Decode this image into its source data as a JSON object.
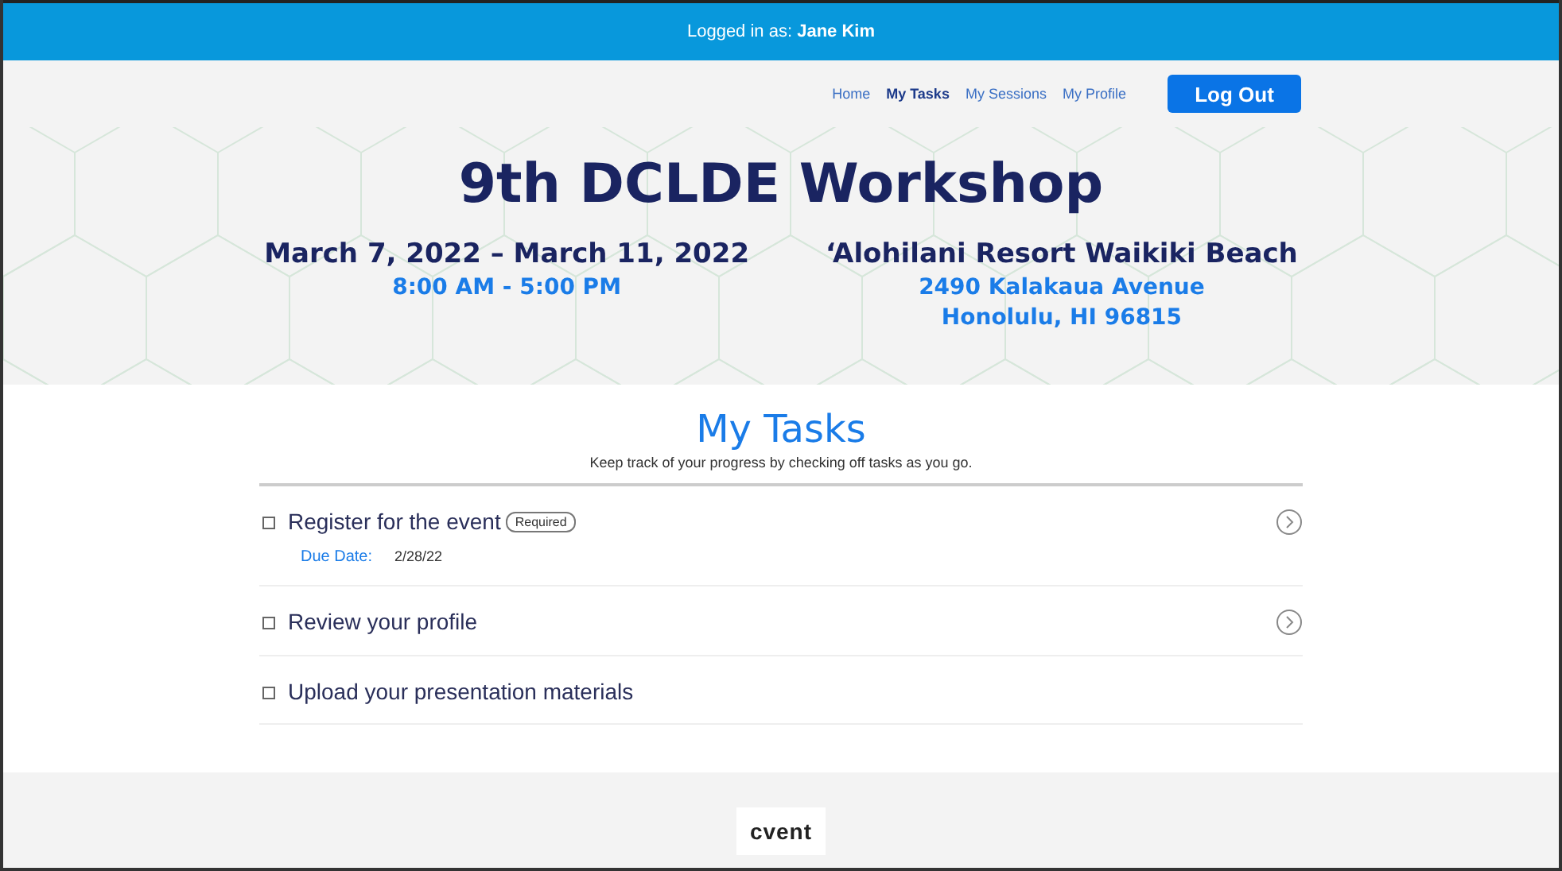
{
  "top_bar": {
    "text": "Logged in as: **Jane Kim**"
  },
  "nav": {
    "links": [
      {
        "label": "Home",
        "selected": false
      },
      {
        "label": "My Tasks",
        "selected": true
      },
      {
        "label": "My Sessions",
        "selected": false
      },
      {
        "label": "My Profile",
        "selected": false
      }
    ],
    "button": "Log Out"
  },
  "hero": {
    "title": "9th DCLDE Workshop",
    "dates": "March 7, 2022 – March 11, 2022",
    "time": "8:00 AM - 5:00 PM",
    "venue": "‘Alohilani Resort Waikiki Beach",
    "address": [
      "2490 Kalakaua Avenue",
      "Honolulu, HI 96815"
    ]
  },
  "tasks": {
    "title": "My Tasks",
    "subtitle": "Keep track of your progress by checking off tasks as you go.",
    "items": [
      {
        "label": "Register for the event",
        "checked": false,
        "badge": "Required",
        "due_label": "Due Date:",
        "due_date": "2/28/22",
        "has_link": true
      },
      {
        "label": "Review your profile",
        "checked": false,
        "has_link": true
      },
      {
        "label": "Upload your presentation materials",
        "checked": false,
        "has_link": false
      }
    ]
  },
  "footer": {
    "logo": "cvent"
  }
}
